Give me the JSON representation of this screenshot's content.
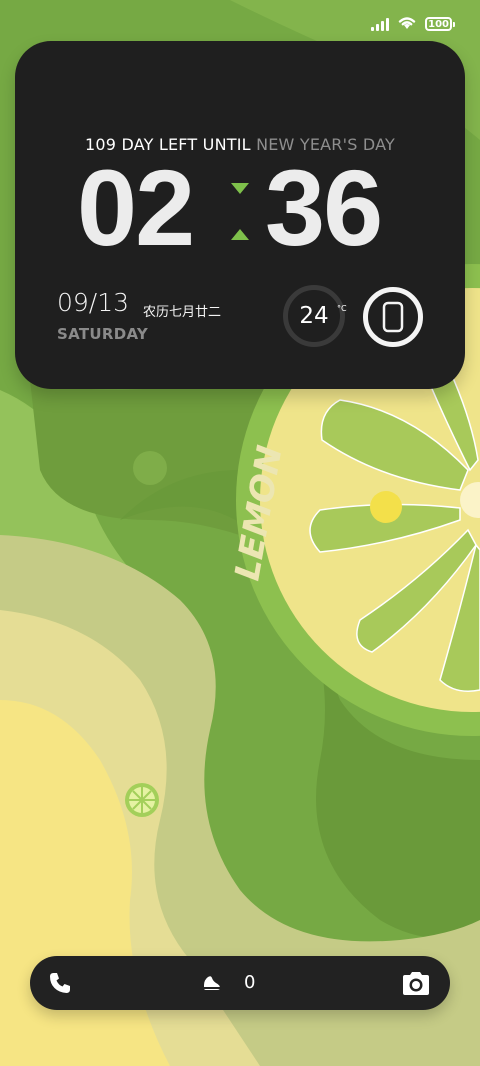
{
  "status_bar": {
    "signal_bars": 4,
    "battery": "100"
  },
  "widget": {
    "countdown_prefix": "109 DAY LEFT UNTIL",
    "countdown_event": "NEW YEAR'S DAY",
    "hour": "02",
    "minute": "36",
    "date": "09/13",
    "lunar_date": "农历七月廿二",
    "weekday": "SATURDAY",
    "temperature": "24",
    "temperature_unit": "°C",
    "accent_color": "#7ec04b"
  },
  "wallpaper": {
    "text": "LEMON"
  },
  "dock": {
    "steps": "0"
  }
}
